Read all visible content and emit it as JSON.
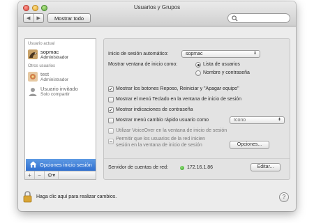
{
  "window": {
    "title": "Usuarios y Grupos"
  },
  "toolbar": {
    "back": "◀",
    "forward": "▶",
    "show_all": "Mostrar todo",
    "search_placeholder": ""
  },
  "sidebar": {
    "current_user_header": "Usuario actual",
    "current_user": {
      "name": "sopmac",
      "role": "Administrador"
    },
    "other_users_header": "Otros usuarios",
    "other_users": [
      {
        "name": "test",
        "role": "Administrador"
      },
      {
        "name": "Usuario invitado",
        "role": "Solo compartir"
      }
    ],
    "login_options": "Opciones inicio sesión",
    "bottom": {
      "add": "+",
      "remove": "−",
      "gear": "⚙▾"
    }
  },
  "panel": {
    "auto_login_label": "Inicio de sesión automático:",
    "auto_login_value": "sopmac",
    "display_label": "Mostrar ventana de inicio como:",
    "display_options": [
      "Lista de usuarios",
      "Nombre y contraseña"
    ],
    "display_selected": 0,
    "checkboxes": [
      {
        "label": "Mostrar los botones Reposo, Reiniciar y \"Apagar equipo\"",
        "checked": true
      },
      {
        "label": "Mostrar el menú Teclado en la ventana de inicio de sesión",
        "checked": false
      },
      {
        "label": "Mostrar indicaciones de contraseña",
        "checked": true
      },
      {
        "label": "Mostrar menú cambio rápido usuario como",
        "checked": false,
        "popup": "Icono"
      },
      {
        "label": "Utilizar VoiceOver en la ventana de inicio de sesión",
        "checked": false
      },
      {
        "label_line1": "Permitir que los usuarios de la red inicien",
        "label_line2": "sesión en la ventana de inicio de sesión",
        "checked": false,
        "button": "Opciones..."
      }
    ],
    "network_server_label": "Servidor de cuentas de red:",
    "network_server_value": "172.16.1.86",
    "edit_button": "Editar..."
  },
  "footer": {
    "lock_text": "Haga clic aquí para realizar cambios.",
    "help": "?"
  }
}
